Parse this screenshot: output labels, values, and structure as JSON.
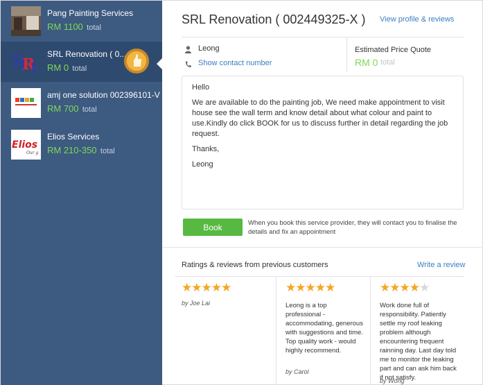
{
  "providers": [
    {
      "name": "Pang Painting Services",
      "price": "RM 1100",
      "total": "total"
    },
    {
      "name": "SRL Renovation ( 0...",
      "price": "RM 0",
      "total": "total"
    },
    {
      "name": "amj one solution 002396101-V",
      "price": "RM 700",
      "total": "total"
    },
    {
      "name": "Elios Services",
      "price": "RM 210-350",
      "total": "total"
    }
  ],
  "detail": {
    "title": "SRL Renovation ( 002449325-X )",
    "view_profile": "View profile & reviews",
    "contact_name": "Leong",
    "show_contact": "Show contact number",
    "quote_label": "Estimated Price Quote",
    "quote_amount": "RM 0",
    "quote_total": "total"
  },
  "message": {
    "greeting": "Hello",
    "body": "We are available to do the painting job, We need make appointment to visit house see the wall term and know detail about what colour and paint to use.Kindly do click BOOK for us to discuss further in detail regarding the job request.",
    "thanks": "Thanks,",
    "signature": "Leong"
  },
  "book": {
    "label": "Book",
    "note": "When you book this service provider, they will contact you to finalise the details and fix an appointment"
  },
  "reviews_section": {
    "heading": "Ratings & reviews from previous customers",
    "write_review": "Write a review",
    "items": [
      {
        "stars": 5,
        "text": "",
        "author": "by Joe Lai"
      },
      {
        "stars": 5,
        "text": "Leong is a top professional - accommodating, generous with suggestions and time. Top quality work - would highly recommend.",
        "author": "by Carol"
      },
      {
        "stars": 4,
        "text": "Work done full of responsibility. Patiently settle my roof leaking problem although encountering frequent rainning day. Last day told me to monitor the leaking part and can ask him back if not satisfy.",
        "author": "by Wong"
      }
    ]
  },
  "icons": {
    "user": "user-icon",
    "phone": "phone-icon",
    "badge": "champion-badge-icon"
  },
  "colors": {
    "sidebar": "#3d5a80",
    "price_green": "#7ed957",
    "book_green": "#57b941",
    "link_blue": "#3a7fc1",
    "star": "#f5a623"
  }
}
